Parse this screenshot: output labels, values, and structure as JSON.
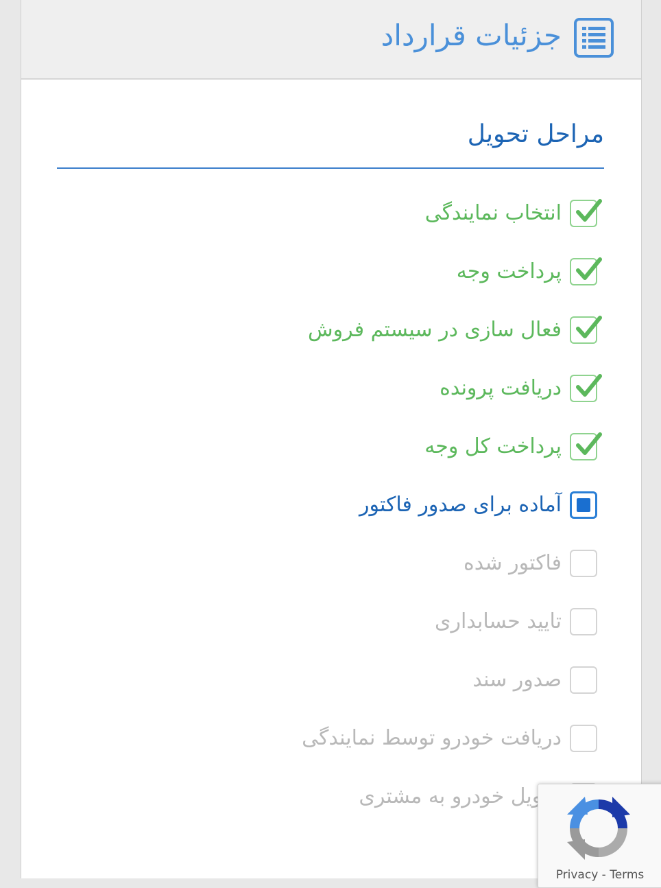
{
  "header": {
    "title": "جزئیات قرارداد",
    "icon": "list-icon",
    "icon_color": "#4a90d9"
  },
  "section": {
    "title": "مراحل تحویل"
  },
  "colors": {
    "done": "#5cb85c",
    "current": "#1c64b4",
    "pending": "#b8b8b8"
  },
  "steps": [
    {
      "label": "انتخاب نمایندگی",
      "status": "done"
    },
    {
      "label": "پرداخت وجه",
      "status": "done"
    },
    {
      "label": "فعال سازی در سیستم فروش",
      "status": "done"
    },
    {
      "label": "دریافت پرونده",
      "status": "done"
    },
    {
      "label": "پرداخت کل وجه",
      "status": "done"
    },
    {
      "label": "آماده برای صدور فاکتور",
      "status": "current"
    },
    {
      "label": "فاکتور شده",
      "status": "pending"
    },
    {
      "label": "تایید حسابداری",
      "status": "pending"
    },
    {
      "label": "صدور سند",
      "status": "pending"
    },
    {
      "label": "دریافت خودرو توسط نمایندگی",
      "status": "pending"
    },
    {
      "label": "تحویل خودرو به مشتری",
      "status": "pending"
    }
  ],
  "recaptcha": {
    "privacy": "Privacy",
    "separator": "-",
    "terms": "Terms",
    "icon": "recaptcha-logo-icon"
  }
}
